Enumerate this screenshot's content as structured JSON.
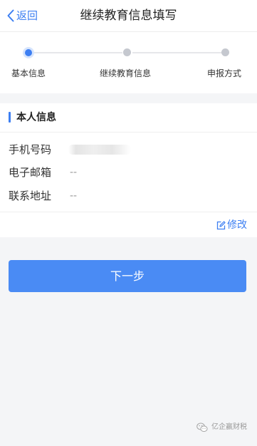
{
  "nav": {
    "back_label": "返回",
    "title": "继续教育信息填写"
  },
  "steps": [
    {
      "label": "基本信息",
      "state": "active"
    },
    {
      "label": "继续教育信息",
      "state": "inactive"
    },
    {
      "label": "申报方式",
      "state": "inactive"
    }
  ],
  "section": {
    "title": "本人信息",
    "rows": [
      {
        "label": "手机号码",
        "value": ""
      },
      {
        "label": "电子邮箱",
        "value": "--"
      },
      {
        "label": "联系地址",
        "value": "--"
      }
    ],
    "edit_label": "修改"
  },
  "next_button": "下一步",
  "watermark": "亿企赢财税",
  "colors": {
    "accent": "#3d7ff2",
    "button": "#4a8bf4",
    "background": "#f4f5f7"
  },
  "icons": {
    "back": "chevron-left-icon",
    "edit": "edit-icon",
    "watermark": "wechat-icon"
  }
}
